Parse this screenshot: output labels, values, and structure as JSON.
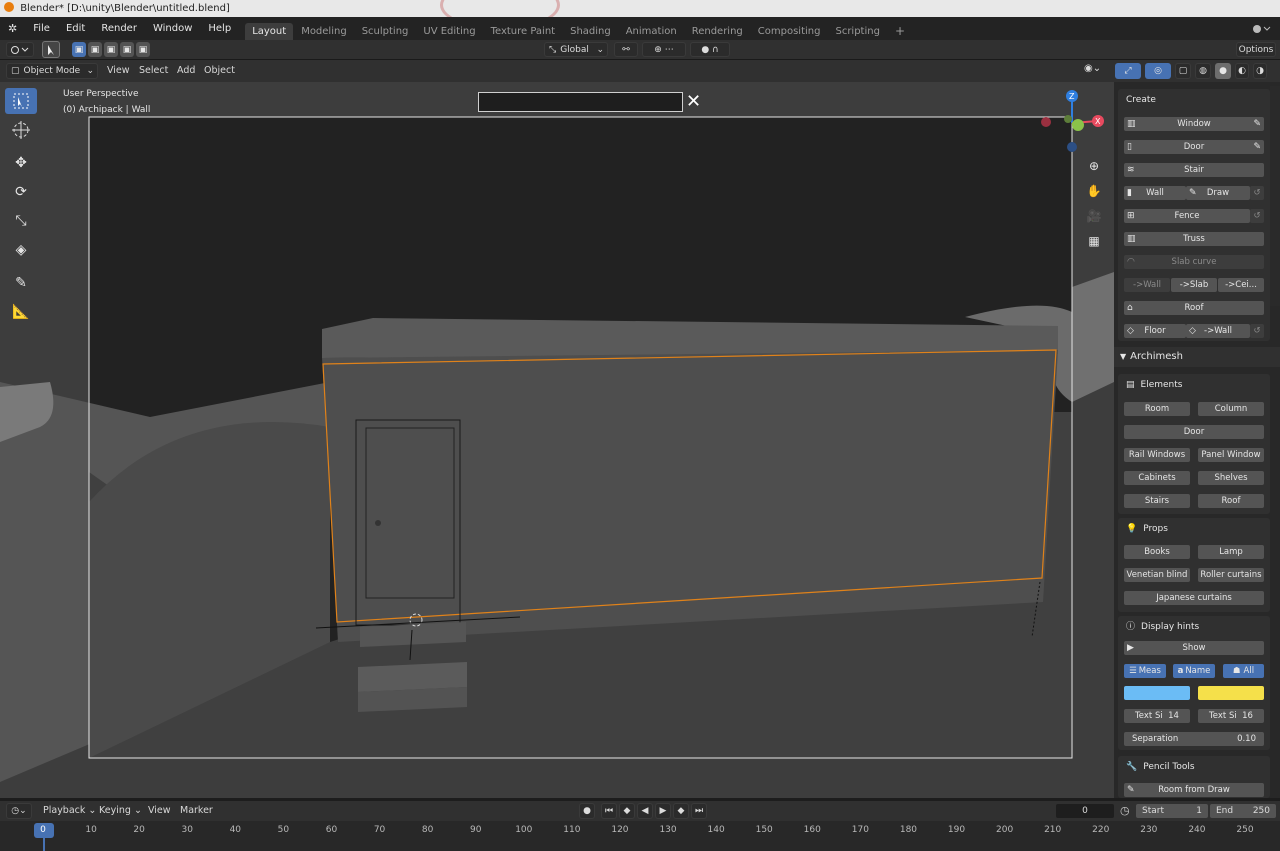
{
  "window": {
    "title": "Blender* [D:\\unity\\Blender\\untitled.blend]"
  },
  "menu": {
    "items": [
      "File",
      "Edit",
      "Render",
      "Window",
      "Help"
    ],
    "workspaces": [
      "Layout",
      "Modeling",
      "Sculpting",
      "UV Editing",
      "Texture Paint",
      "Shading",
      "Animation",
      "Rendering",
      "Compositing",
      "Scripting"
    ],
    "active_workspace": "Layout",
    "add_tab": "+"
  },
  "toolheader": {
    "orientation": "Global",
    "options": "Options"
  },
  "viewheader": {
    "mode": "Object Mode",
    "menus": [
      "View",
      "Select",
      "Add",
      "Object"
    ]
  },
  "viewport": {
    "perspective": "User Perspective",
    "object_info": "(0) Archipack | Wall",
    "search_value": "",
    "close_glyph": "✕",
    "gizmo": {
      "z": "Z",
      "x": "X"
    }
  },
  "sidebar": {
    "create": {
      "title": "Create",
      "window": "Window",
      "door": "Door",
      "stair": "Stair",
      "wall": "Wall",
      "draw": "Draw",
      "fence": "Fence",
      "truss": "Truss",
      "slab_curve": "Slab curve",
      "to_wall": "->Wall",
      "to_slab": "->Slab",
      "to_ceiling": "->Cei...",
      "roof": "Roof",
      "floor": "Floor",
      "floor_to_wall": "->Wall"
    },
    "archimesh": {
      "title": "Archimesh",
      "elements": {
        "title": "Elements",
        "room": "Room",
        "column": "Column",
        "door": "Door",
        "rail_windows": "Rail Windows",
        "panel_window": "Panel Window",
        "cabinets": "Cabinets",
        "shelves": "Shelves",
        "stairs": "Stairs",
        "roof": "Roof"
      },
      "props": {
        "title": "Props",
        "books": "Books",
        "lamp": "Lamp",
        "venetian_blind": "Venetian blind",
        "roller_curtains": "Roller curtains",
        "japanese_curtains": "Japanese curtains"
      },
      "display_hints": {
        "title": "Display hints",
        "show": "Show",
        "meas": "Meas",
        "name": "Name",
        "all": "All",
        "color_1": "#6bbcf5",
        "color_2": "#f5e04a",
        "text_size_1_label": "Text Si",
        "text_size_1_value": "14",
        "text_size_2_label": "Text Si",
        "text_size_2_value": "16",
        "separation_label": "Separation",
        "separation_value": "0.10"
      },
      "pencil_tools": {
        "title": "Pencil Tools",
        "room_from_draw": "Room from Draw"
      }
    }
  },
  "timeline": {
    "menus": [
      "Playback",
      "Keying",
      "View",
      "Marker"
    ],
    "current_frame": "0",
    "start_label": "Start",
    "start_value": "1",
    "end_label": "End",
    "end_value": "250",
    "ruler": [
      "0",
      "10",
      "20",
      "30",
      "40",
      "50",
      "60",
      "70",
      "80",
      "90",
      "100",
      "110",
      "120",
      "130",
      "140",
      "150",
      "160",
      "170",
      "180",
      "190",
      "200",
      "210",
      "220",
      "230",
      "240",
      "250"
    ]
  },
  "colors": {
    "accent": "#4772b3",
    "selection_outline": "#e0821a",
    "gizmo_x": "#e84a5f",
    "gizmo_y": "#8bc34a",
    "gizmo_z": "#2f7fe0"
  }
}
